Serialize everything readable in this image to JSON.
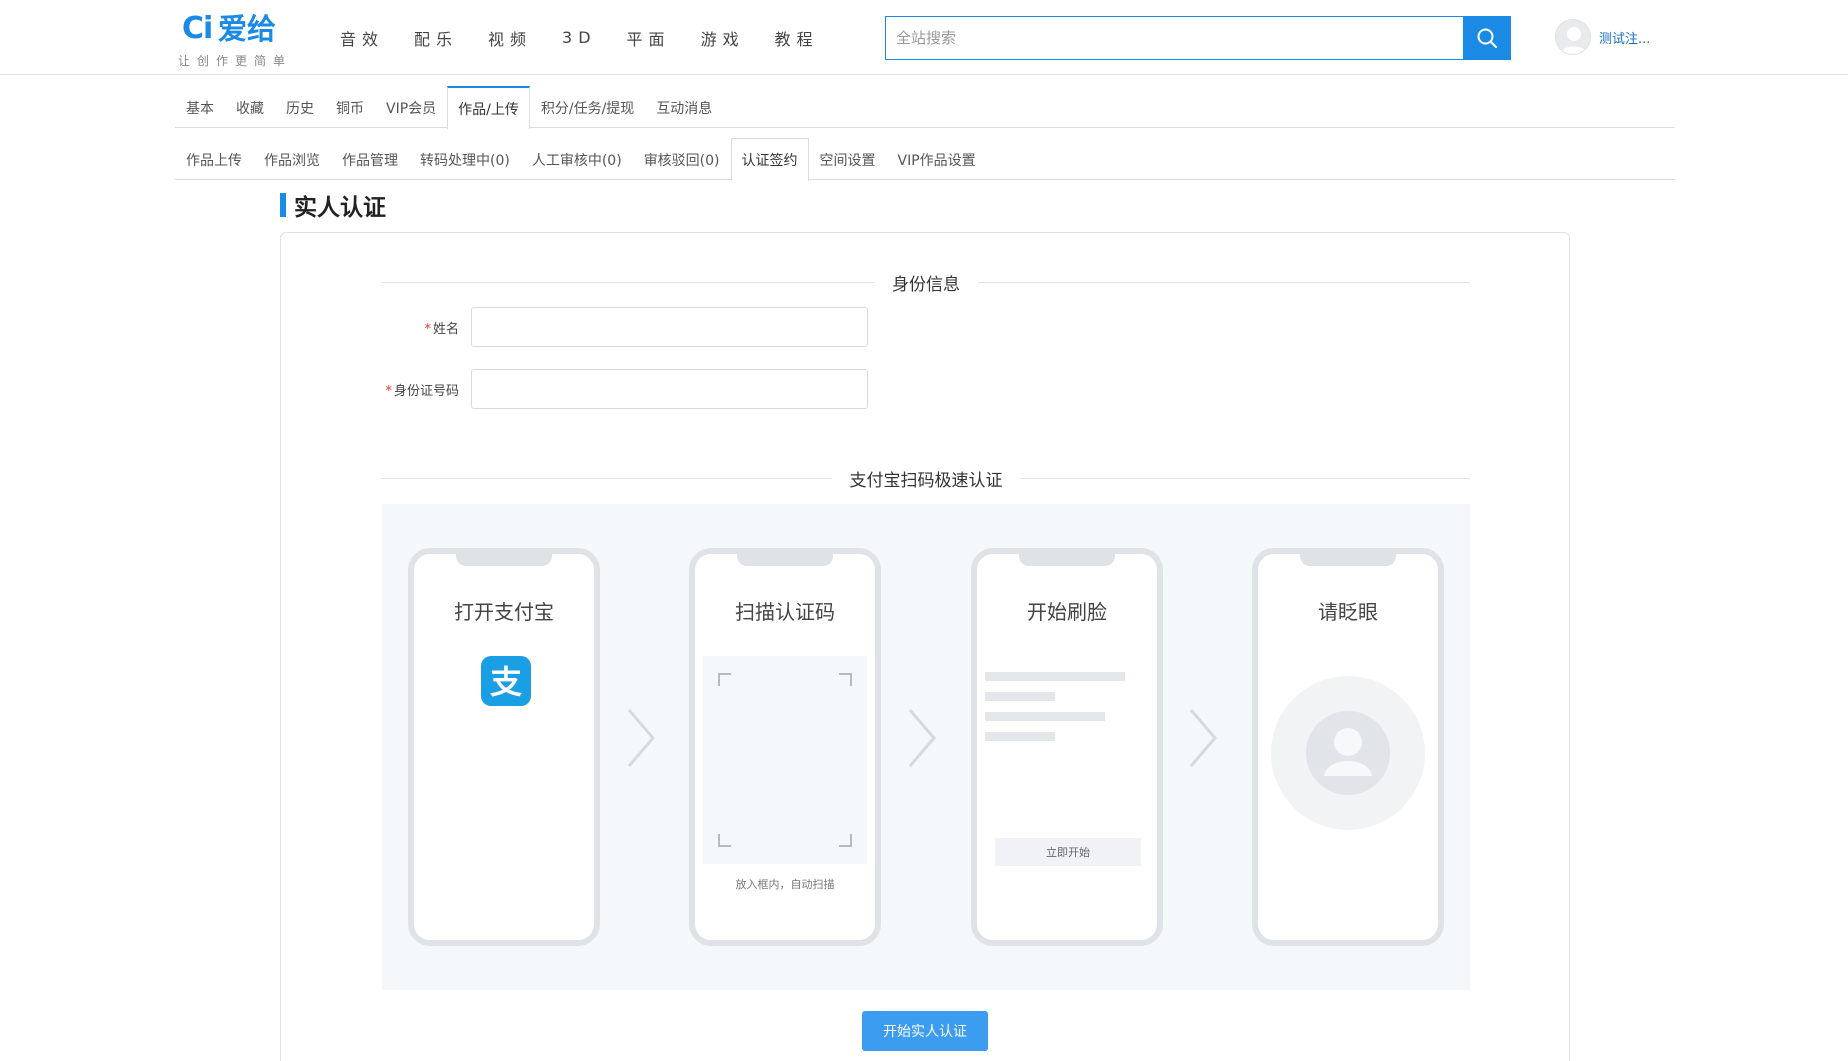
{
  "header": {
    "logo_mark": "Ci",
    "logo_name": "爱给",
    "slogan": "让创作更简单",
    "nav": [
      "音效",
      "配乐",
      "视频",
      "3D",
      "平面",
      "游戏",
      "教程"
    ],
    "search_placeholder": "全站搜索",
    "user_name": "测试注..."
  },
  "tabs_primary": [
    {
      "label": "基本",
      "active": false
    },
    {
      "label": "收藏",
      "active": false
    },
    {
      "label": "历史",
      "active": false
    },
    {
      "label": "铜币",
      "active": false
    },
    {
      "label": "VIP会员",
      "active": false
    },
    {
      "label": "作品/上传",
      "active": true
    },
    {
      "label": "积分/任务/提现",
      "active": false
    },
    {
      "label": "互动消息",
      "active": false
    }
  ],
  "tabs_secondary": [
    {
      "label": "作品上传",
      "active": false
    },
    {
      "label": "作品浏览",
      "active": false
    },
    {
      "label": "作品管理",
      "active": false
    },
    {
      "label": "转码处理中(0)",
      "active": false
    },
    {
      "label": "人工审核中(0)",
      "active": false
    },
    {
      "label": "审核驳回(0)",
      "active": false
    },
    {
      "label": "认证签约",
      "active": true
    },
    {
      "label": "空间设置",
      "active": false
    },
    {
      "label": "VIP作品设置",
      "active": false
    }
  ],
  "page_title": "实人认证",
  "identity": {
    "section_title": "身份信息",
    "required_mark": "*",
    "name_label": "姓名",
    "name_value": "",
    "id_label": "身份证号码",
    "id_value": ""
  },
  "alipay": {
    "section_title": "支付宝扫码极速认证",
    "steps": [
      {
        "title": "打开支付宝",
        "icon": "alipay-icon"
      },
      {
        "title": "扫描认证码",
        "hint": "放入框内，自动扫描"
      },
      {
        "title": "开始刷脸",
        "button": "立即开始"
      },
      {
        "title": "请眨眼",
        "icon": "user-silhouette-icon"
      }
    ],
    "alipay_glyph": "支"
  },
  "submit_label": "开始实人认证",
  "colors": {
    "brand": "#1a8ae5",
    "button": "#3b9cf0",
    "required": "#e6352b",
    "steps_background": "#f5f8fb"
  }
}
